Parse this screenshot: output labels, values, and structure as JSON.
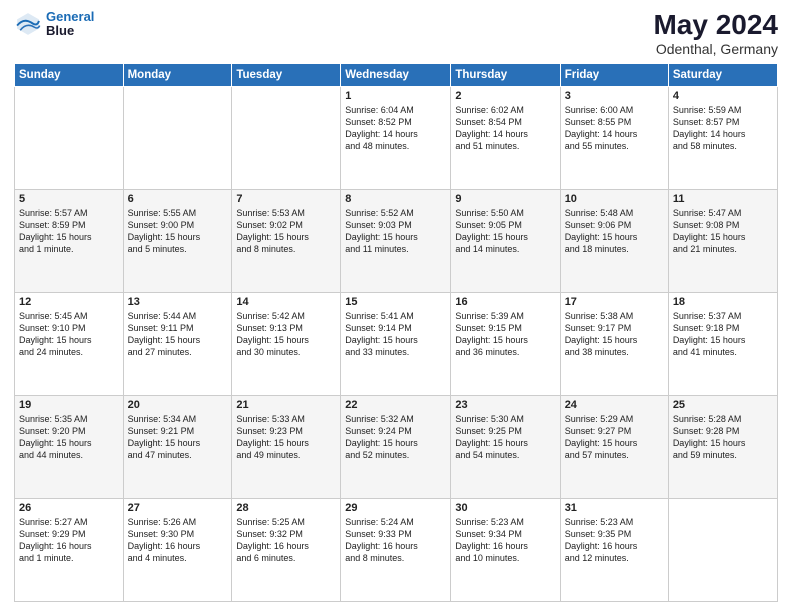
{
  "logo": {
    "line1": "General",
    "line2": "Blue"
  },
  "title": "May 2024",
  "subtitle": "Odenthal, Germany",
  "weekdays": [
    "Sunday",
    "Monday",
    "Tuesday",
    "Wednesday",
    "Thursday",
    "Friday",
    "Saturday"
  ],
  "weeks": [
    [
      {
        "day": "",
        "text": ""
      },
      {
        "day": "",
        "text": ""
      },
      {
        "day": "",
        "text": ""
      },
      {
        "day": "1",
        "text": "Sunrise: 6:04 AM\nSunset: 8:52 PM\nDaylight: 14 hours\nand 48 minutes."
      },
      {
        "day": "2",
        "text": "Sunrise: 6:02 AM\nSunset: 8:54 PM\nDaylight: 14 hours\nand 51 minutes."
      },
      {
        "day": "3",
        "text": "Sunrise: 6:00 AM\nSunset: 8:55 PM\nDaylight: 14 hours\nand 55 minutes."
      },
      {
        "day": "4",
        "text": "Sunrise: 5:59 AM\nSunset: 8:57 PM\nDaylight: 14 hours\nand 58 minutes."
      }
    ],
    [
      {
        "day": "5",
        "text": "Sunrise: 5:57 AM\nSunset: 8:59 PM\nDaylight: 15 hours\nand 1 minute."
      },
      {
        "day": "6",
        "text": "Sunrise: 5:55 AM\nSunset: 9:00 PM\nDaylight: 15 hours\nand 5 minutes."
      },
      {
        "day": "7",
        "text": "Sunrise: 5:53 AM\nSunset: 9:02 PM\nDaylight: 15 hours\nand 8 minutes."
      },
      {
        "day": "8",
        "text": "Sunrise: 5:52 AM\nSunset: 9:03 PM\nDaylight: 15 hours\nand 11 minutes."
      },
      {
        "day": "9",
        "text": "Sunrise: 5:50 AM\nSunset: 9:05 PM\nDaylight: 15 hours\nand 14 minutes."
      },
      {
        "day": "10",
        "text": "Sunrise: 5:48 AM\nSunset: 9:06 PM\nDaylight: 15 hours\nand 18 minutes."
      },
      {
        "day": "11",
        "text": "Sunrise: 5:47 AM\nSunset: 9:08 PM\nDaylight: 15 hours\nand 21 minutes."
      }
    ],
    [
      {
        "day": "12",
        "text": "Sunrise: 5:45 AM\nSunset: 9:10 PM\nDaylight: 15 hours\nand 24 minutes."
      },
      {
        "day": "13",
        "text": "Sunrise: 5:44 AM\nSunset: 9:11 PM\nDaylight: 15 hours\nand 27 minutes."
      },
      {
        "day": "14",
        "text": "Sunrise: 5:42 AM\nSunset: 9:13 PM\nDaylight: 15 hours\nand 30 minutes."
      },
      {
        "day": "15",
        "text": "Sunrise: 5:41 AM\nSunset: 9:14 PM\nDaylight: 15 hours\nand 33 minutes."
      },
      {
        "day": "16",
        "text": "Sunrise: 5:39 AM\nSunset: 9:15 PM\nDaylight: 15 hours\nand 36 minutes."
      },
      {
        "day": "17",
        "text": "Sunrise: 5:38 AM\nSunset: 9:17 PM\nDaylight: 15 hours\nand 38 minutes."
      },
      {
        "day": "18",
        "text": "Sunrise: 5:37 AM\nSunset: 9:18 PM\nDaylight: 15 hours\nand 41 minutes."
      }
    ],
    [
      {
        "day": "19",
        "text": "Sunrise: 5:35 AM\nSunset: 9:20 PM\nDaylight: 15 hours\nand 44 minutes."
      },
      {
        "day": "20",
        "text": "Sunrise: 5:34 AM\nSunset: 9:21 PM\nDaylight: 15 hours\nand 47 minutes."
      },
      {
        "day": "21",
        "text": "Sunrise: 5:33 AM\nSunset: 9:23 PM\nDaylight: 15 hours\nand 49 minutes."
      },
      {
        "day": "22",
        "text": "Sunrise: 5:32 AM\nSunset: 9:24 PM\nDaylight: 15 hours\nand 52 minutes."
      },
      {
        "day": "23",
        "text": "Sunrise: 5:30 AM\nSunset: 9:25 PM\nDaylight: 15 hours\nand 54 minutes."
      },
      {
        "day": "24",
        "text": "Sunrise: 5:29 AM\nSunset: 9:27 PM\nDaylight: 15 hours\nand 57 minutes."
      },
      {
        "day": "25",
        "text": "Sunrise: 5:28 AM\nSunset: 9:28 PM\nDaylight: 15 hours\nand 59 minutes."
      }
    ],
    [
      {
        "day": "26",
        "text": "Sunrise: 5:27 AM\nSunset: 9:29 PM\nDaylight: 16 hours\nand 1 minute."
      },
      {
        "day": "27",
        "text": "Sunrise: 5:26 AM\nSunset: 9:30 PM\nDaylight: 16 hours\nand 4 minutes."
      },
      {
        "day": "28",
        "text": "Sunrise: 5:25 AM\nSunset: 9:32 PM\nDaylight: 16 hours\nand 6 minutes."
      },
      {
        "day": "29",
        "text": "Sunrise: 5:24 AM\nSunset: 9:33 PM\nDaylight: 16 hours\nand 8 minutes."
      },
      {
        "day": "30",
        "text": "Sunrise: 5:23 AM\nSunset: 9:34 PM\nDaylight: 16 hours\nand 10 minutes."
      },
      {
        "day": "31",
        "text": "Sunrise: 5:23 AM\nSunset: 9:35 PM\nDaylight: 16 hours\nand 12 minutes."
      },
      {
        "day": "",
        "text": ""
      }
    ]
  ]
}
